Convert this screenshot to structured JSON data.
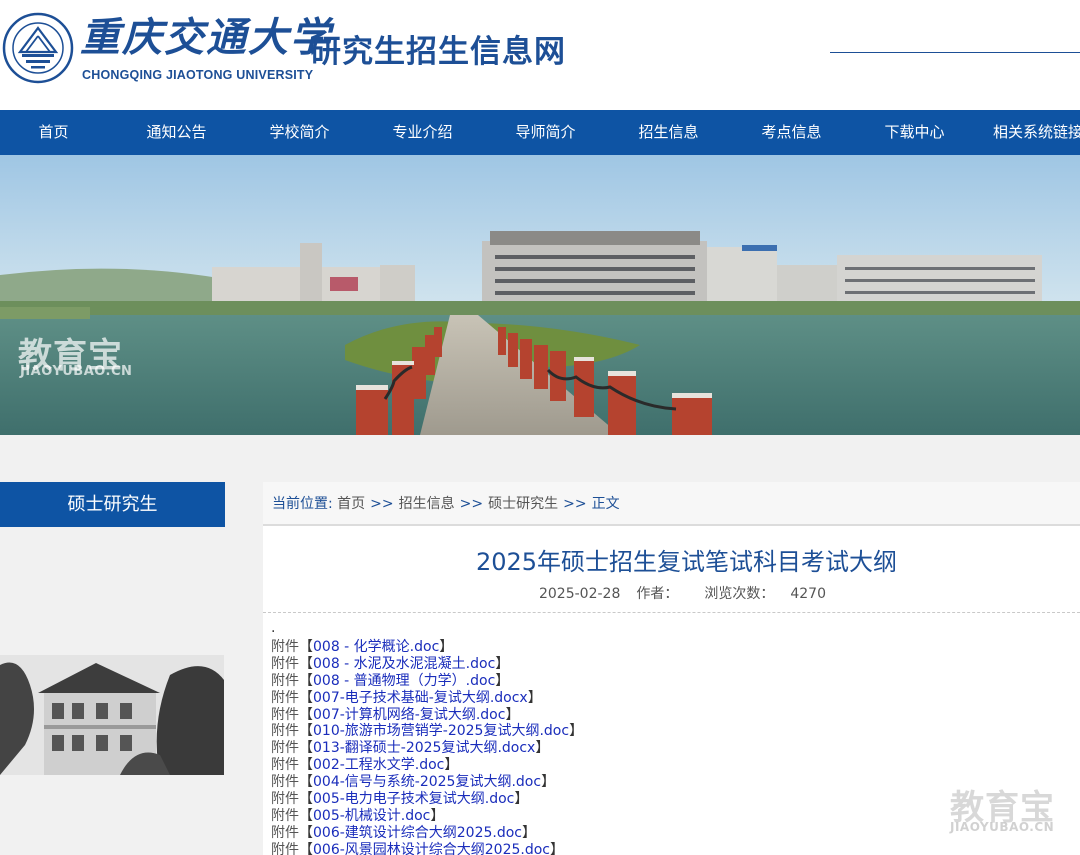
{
  "header": {
    "logo_text_cn": "重庆交通大学",
    "logo_text_en": "CHONGQING JIAOTONG UNIVERSITY",
    "site_title": "研究生招生信息网"
  },
  "nav": {
    "items": [
      {
        "label": "首页"
      },
      {
        "label": "通知公告"
      },
      {
        "label": "学校简介"
      },
      {
        "label": "专业介绍"
      },
      {
        "label": "导师简介"
      },
      {
        "label": "招生信息"
      },
      {
        "label": "考点信息"
      },
      {
        "label": "下载中心"
      },
      {
        "label": "相关系统链接"
      }
    ]
  },
  "watermark": {
    "cn": "教育宝",
    "en": "JIAOYUBAO.CN"
  },
  "sidebar": {
    "title": "硕士研究生"
  },
  "breadcrumb": {
    "label": "当前位置:",
    "items": [
      "首页",
      "招生信息",
      "硕士研究生"
    ],
    "separator": ">>",
    "current": "正文"
  },
  "article": {
    "title": "2025年硕士招生复试笔试科目考试大纲",
    "date": "2025-02-28",
    "author_label": "作者：",
    "views_label": "浏览次数：",
    "views": "4270",
    "dot": ".",
    "attachment_prefix": "附件",
    "attachments": [
      "008 - 化学概论.doc",
      "008 - 水泥及水泥混凝土.doc",
      "008 - 普通物理（力学）.doc",
      "007-电子技术基础-复试大纲.docx",
      "007-计算机网络-复试大纲.doc",
      "010-旅游市场营销学-2025复试大纲.doc",
      "013-翻译硕士-2025复试大纲.docx",
      "002-工程水文学.doc",
      "004-信号与系统-2025复试大纲.doc",
      "005-电力电子技术复试大纲.doc",
      "005-机械设计.doc",
      "006-建筑设计综合大纲2025.doc",
      "006-风景园林设计综合大纲2025.doc"
    ]
  }
}
